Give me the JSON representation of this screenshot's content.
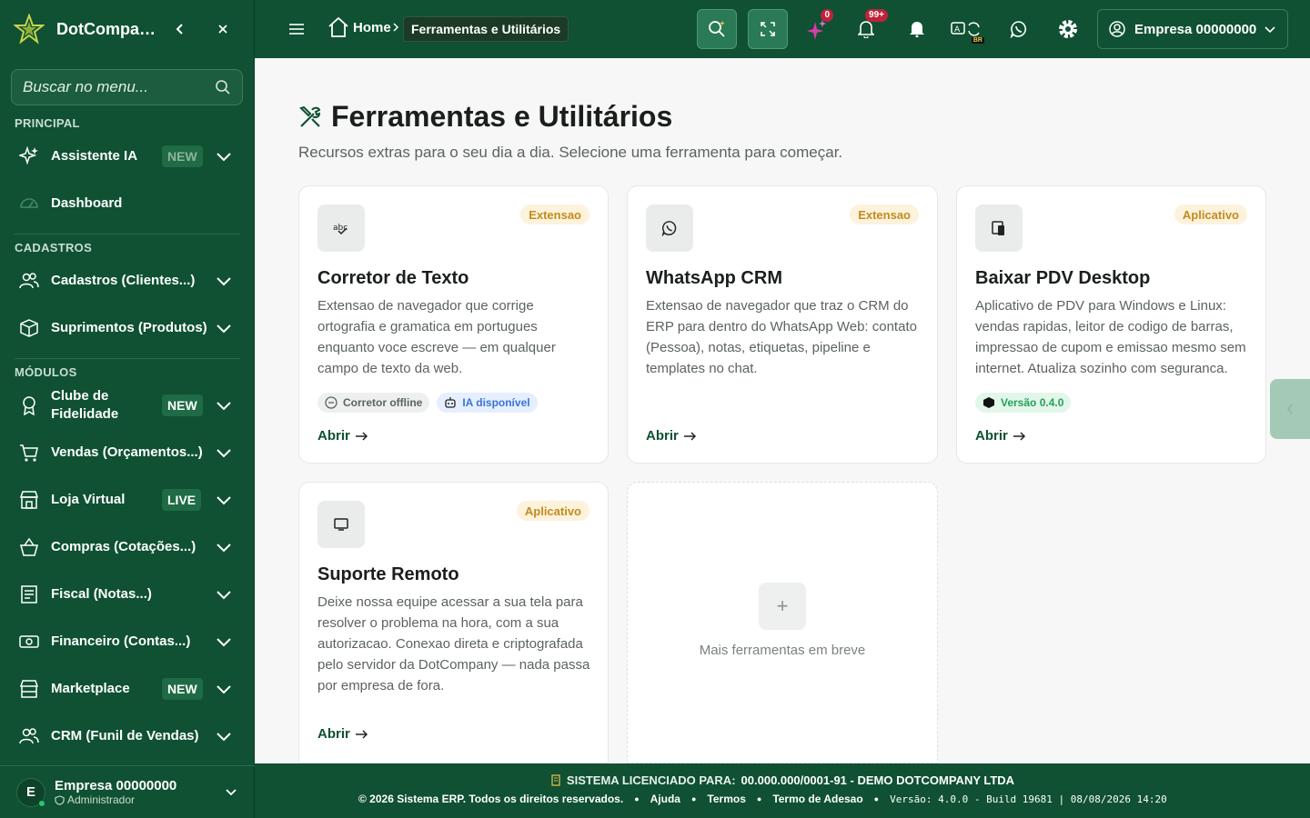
{
  "app": {
    "name": "DotCompany",
    "brand_display": "DotCompan..."
  },
  "colors": {
    "primary": "#0f5132",
    "accent_badge": "#c0223b",
    "tag_bg": "#fdf2dc",
    "tag_text": "#c48b1d"
  },
  "sidebar": {
    "search_placeholder": "Buscar no menu...",
    "sections": {
      "principal": "PRINCIPAL",
      "cadastros": "CADASTROS",
      "modulos": "MÓDULOS"
    },
    "items": [
      {
        "label": "Assistente IA",
        "icon": "sparkle-icon",
        "badge": "NEW"
      },
      {
        "label": "Dashboard",
        "icon": "gauge-icon"
      },
      {
        "label": "Cadastros (Clientes...)",
        "icon": "users-icon"
      },
      {
        "label": "Suprimentos (Produtos)",
        "icon": "box-icon"
      },
      {
        "label": "Clube de Fidelidade",
        "icon": "award-icon",
        "badge": "NEW"
      },
      {
        "label": "Vendas (Orçamentos...)",
        "icon": "cart-icon"
      },
      {
        "label": "Loja Virtual",
        "icon": "store-icon",
        "badge": "LIVE"
      },
      {
        "label": "Compras (Cotações...)",
        "icon": "basket-icon"
      },
      {
        "label": "Fiscal (Notas...)",
        "icon": "receipt-icon"
      },
      {
        "label": "Financeiro (Contas...)",
        "icon": "money-icon"
      },
      {
        "label": "Marketplace",
        "icon": "shop-icon",
        "badge": "NEW"
      },
      {
        "label": "CRM (Funil de Vendas)",
        "icon": "users-icon"
      }
    ],
    "user": {
      "initial": "E",
      "name": "Empresa 00000000",
      "role": "Administrador"
    }
  },
  "header": {
    "breadcrumb_home": "Home",
    "breadcrumb_current": "Ferramentas e Utilitários",
    "ai_count": "0",
    "notif_count": "99+",
    "lang_badge": "BR",
    "company": "Empresa 00000000"
  },
  "page": {
    "title": "Ferramentas e Utilitários",
    "subtitle": "Recursos extras para o seu dia a dia. Selecione uma ferramenta para começar."
  },
  "cards": [
    {
      "tag": "Extensao",
      "title": "Corretor de Texto",
      "description": "Extensao de navegador que corrige ortografia e gramatica em portugues enquanto voce escreve — em qualquer campo de texto da web.",
      "chips": [
        "Corretor offline",
        "IA disponível"
      ],
      "action": "Abrir"
    },
    {
      "tag": "Extensao",
      "title": "WhatsApp CRM",
      "description": "Extensao de navegador que traz o CRM do ERP para dentro do WhatsApp Web: contato (Pessoa), notas, etiquetas, pipeline e templates no chat.",
      "action": "Abrir"
    },
    {
      "tag": "Aplicativo",
      "title": "Baixar PDV Desktop",
      "description": "Aplicativo de PDV para Windows e Linux: vendas rapidas, leitor de codigo de barras, impressao de cupom e emissao mesmo sem internet. Atualiza sozinho com seguranca.",
      "chips": [
        "Versão 0.4.0"
      ],
      "action": "Abrir"
    },
    {
      "tag": "Aplicativo",
      "title": "Suporte Remoto",
      "description": "Deixe nossa equipe acessar a sua tela para resolver o problema na hora, com a sua autorizacao. Conexao direta e criptografada pelo servidor da DotCompany — nada passa por empresa de fora.",
      "action": "Abrir"
    }
  ],
  "placeholder": {
    "text": "Mais ferramentas em breve"
  },
  "footer": {
    "license_label": "SISTEMA LICENCIADO PARA:",
    "license_value": "00.000.000/0001-91 - DEMO DOTCOMPANY LTDA",
    "copyright": "© 2026 Sistema ERP. Todos os direitos reservados.",
    "links": [
      "Ajuda",
      "Termos",
      "Termo de Adesao"
    ],
    "version": "Versão: 4.0.0 - Build 19681 | 08/08/2026 14:20"
  }
}
